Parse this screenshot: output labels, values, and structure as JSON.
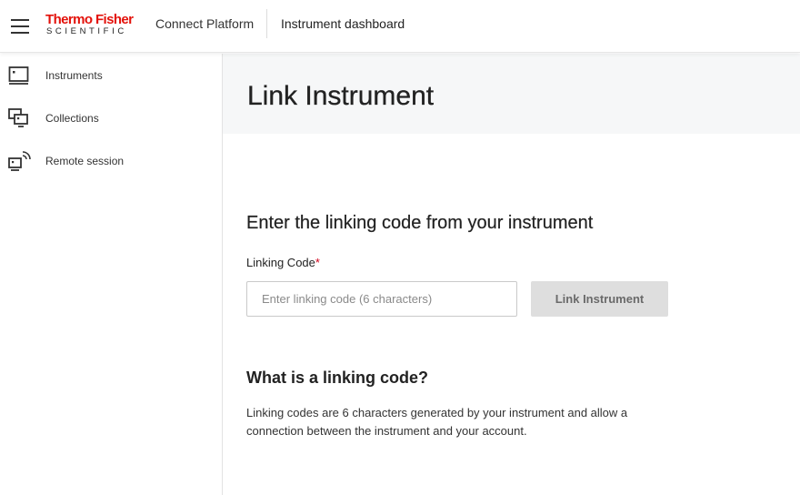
{
  "brand": {
    "name": "Thermo Fisher",
    "subtitle": "SCIENTIFIC",
    "accent_color": "#e3120b"
  },
  "header": {
    "platform": "Connect Platform",
    "page": "Instrument dashboard"
  },
  "sidebar": {
    "items": [
      {
        "label": "Instruments",
        "icon": "monitor-icon"
      },
      {
        "label": "Collections",
        "icon": "collections-icon"
      },
      {
        "label": "Remote session",
        "icon": "remote-session-icon"
      }
    ]
  },
  "main": {
    "title": "Link Instrument",
    "section_title": "Enter the linking code from your instrument",
    "field_label": "Linking Code",
    "required_mark": "*",
    "input_value": "",
    "input_placeholder": "Enter linking code (6 characters)",
    "submit_label": "Link Instrument",
    "info_title": "What is a linking code?",
    "info_text": "Linking codes are 6 characters generated by your instrument and allow a connection between the instrument and your account."
  }
}
